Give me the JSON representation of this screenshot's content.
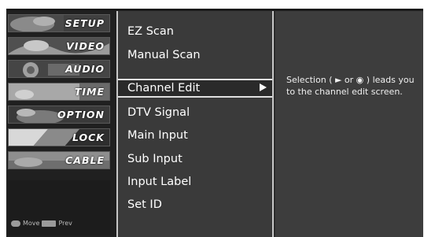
{
  "sidebar": {
    "items": [
      {
        "label": "SETUP",
        "art": "#7a8a7a"
      },
      {
        "label": "VIDEO",
        "art": "#8a8a8a"
      },
      {
        "label": "AUDIO",
        "art": "#6a6a6a"
      },
      {
        "label": "TIME",
        "art": "#9a9a9a"
      },
      {
        "label": "OPTION",
        "art": "#5e5e5e"
      },
      {
        "label": "LOCK",
        "art": "#8e8e8e"
      },
      {
        "label": "CABLE",
        "art": "#7e7e7e"
      }
    ],
    "footer": {
      "move_label": "Move",
      "prev_label": "Prev"
    }
  },
  "menu": {
    "items": [
      {
        "label": "EZ Scan"
      },
      {
        "label": "Manual Scan"
      },
      {
        "label": "Channel Edit"
      },
      {
        "label": "DTV Signal"
      },
      {
        "label": "Main Input"
      },
      {
        "label": "Sub Input"
      },
      {
        "label": "Input Label"
      },
      {
        "label": "Set ID"
      }
    ],
    "selected_index": 2
  },
  "description": {
    "text": "Selection ( ► or ◉ ) leads you to the channel edit screen."
  }
}
